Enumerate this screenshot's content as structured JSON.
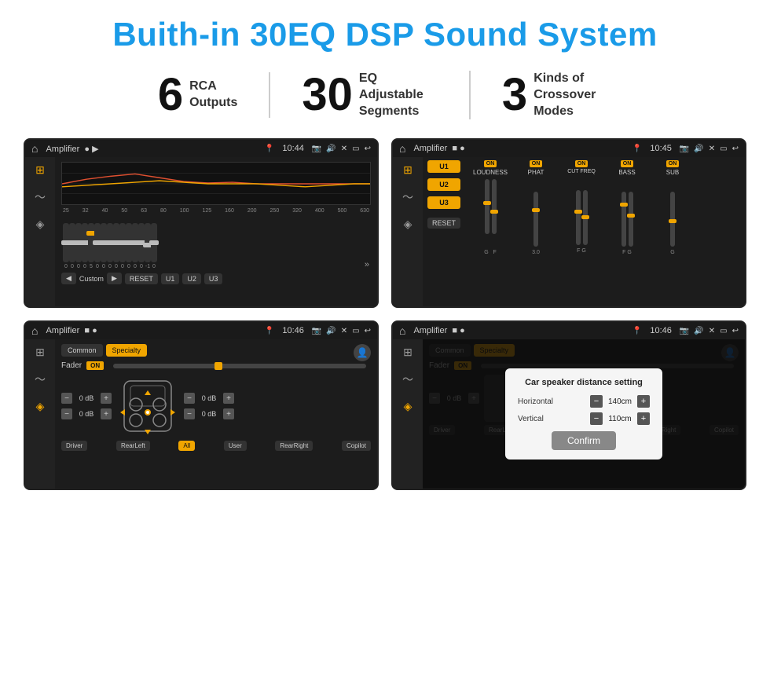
{
  "header": {
    "title": "Buith-in 30EQ DSP Sound System"
  },
  "stats": [
    {
      "number": "6",
      "label": "RCA\nOutputs"
    },
    {
      "number": "30",
      "label": "EQ Adjustable\nSegments"
    },
    {
      "number": "3",
      "label": "Kinds of\nCrossover Modes"
    }
  ],
  "screens": [
    {
      "id": "screen1",
      "statusBar": {
        "title": "Amplifier",
        "time": "10:44"
      },
      "type": "eq"
    },
    {
      "id": "screen2",
      "statusBar": {
        "title": "Amplifier",
        "time": "10:45"
      },
      "type": "mixer"
    },
    {
      "id": "screen3",
      "statusBar": {
        "title": "Amplifier",
        "time": "10:46"
      },
      "type": "fader"
    },
    {
      "id": "screen4",
      "statusBar": {
        "title": "Amplifier",
        "time": "10:46"
      },
      "type": "dialog"
    }
  ],
  "eq": {
    "frequencies": [
      "25",
      "32",
      "40",
      "50",
      "63",
      "80",
      "100",
      "125",
      "160",
      "200",
      "250",
      "320",
      "400",
      "500",
      "630"
    ],
    "values": [
      "0",
      "0",
      "0",
      "0",
      "5",
      "0",
      "0",
      "0",
      "0",
      "0",
      "0",
      "0",
      "0",
      "-1",
      "0",
      "-1"
    ],
    "buttons": [
      "Custom",
      "RESET",
      "U1",
      "U2",
      "U3"
    ]
  },
  "mixer": {
    "presets": [
      "U1",
      "U2",
      "U3"
    ],
    "channels": [
      {
        "name": "LOUDNESS",
        "on": true
      },
      {
        "name": "PHAT",
        "on": true
      },
      {
        "name": "CUT FREQ",
        "on": true
      },
      {
        "name": "BASS",
        "on": true
      },
      {
        "name": "SUB",
        "on": true
      }
    ],
    "resetLabel": "RESET"
  },
  "fader": {
    "tabs": [
      "Common",
      "Specialty"
    ],
    "activeTab": "Specialty",
    "faderLabel": "Fader",
    "onLabel": "ON",
    "volumes": [
      "0 dB",
      "0 dB",
      "0 dB",
      "0 dB"
    ],
    "buttons": [
      "Driver",
      "RearLeft",
      "All",
      "User",
      "RearRight",
      "Copilot"
    ]
  },
  "dialog": {
    "title": "Car speaker distance setting",
    "horizontalLabel": "Horizontal",
    "horizontalValue": "140cm",
    "verticalLabel": "Vertical",
    "verticalValue": "110cm",
    "confirmLabel": "Confirm",
    "faderLabel": "Fader",
    "tabs": [
      "Common",
      "Specialty"
    ]
  }
}
